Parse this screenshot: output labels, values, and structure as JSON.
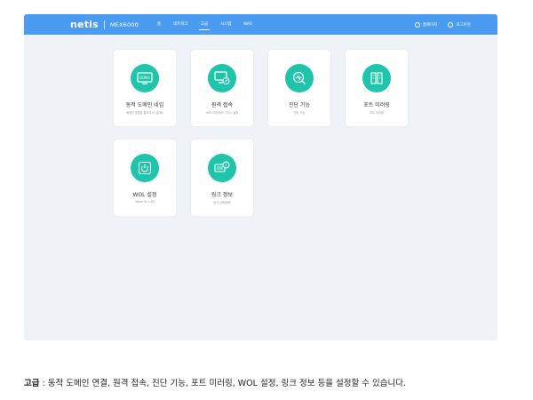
{
  "header": {
    "logo": "netis",
    "model": "MEX6000",
    "nav": [
      {
        "label": "홈",
        "active": false
      },
      {
        "label": "네트워크",
        "active": false
      },
      {
        "label": "고급",
        "active": true
      },
      {
        "label": "시스템",
        "active": false
      },
      {
        "label": "NAS",
        "active": false
      }
    ],
    "actions": [
      {
        "label": "홈페이지",
        "icon": "globe-icon"
      },
      {
        "label": "로그아웃",
        "icon": "logout-icon"
      }
    ]
  },
  "cards": [
    {
      "title": "동적 도메인 네임",
      "sub": "회원번 방법을 통하여 IP 업데트",
      "icon": "ddns-icon"
    },
    {
      "title": "원격 접속",
      "sub": "WPS 외부에서 기기스 설정",
      "icon": "remote-monitor-icon"
    },
    {
      "title": "진단 기능",
      "sub": "진단 기능",
      "icon": "diagnosis-icon"
    },
    {
      "title": "포트 미러링",
      "sub": "포트 미러링",
      "icon": "port-mirror-icon"
    },
    {
      "title": "WOL 설정",
      "sub": "Wake On LAN",
      "icon": "power-icon"
    },
    {
      "title": "링크 정보",
      "sub": "링크 상태/문제",
      "icon": "link-info-icon"
    }
  ],
  "caption": {
    "bold": "고급",
    "text": " : 동적 도메인 연결, 원격 접속, 진단 기능, 포트 미러링, WOL 설정, 링크 정보 등을 설정할 수 있습니다."
  },
  "colors": {
    "topbar": "#4a9cf2",
    "accent": "#1fc4aa",
    "background": "#eff2f6"
  }
}
